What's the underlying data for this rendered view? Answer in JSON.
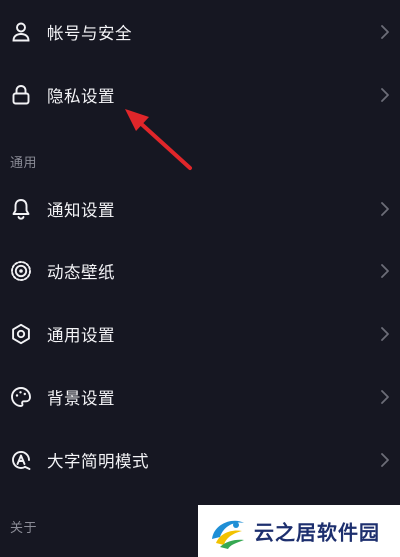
{
  "menu": {
    "account_security": "帐号与安全",
    "privacy": "隐私设置",
    "section_general": "通用",
    "notifications": "通知设置",
    "dynamic_wallpaper": "动态壁纸",
    "general_settings": "通用设置",
    "background": "背景设置",
    "large_text": "大字简明模式",
    "section_about": "关于"
  },
  "icons": {
    "account_security": "person-icon",
    "privacy": "lock-icon",
    "notifications": "bell-icon",
    "dynamic_wallpaper": "wallpaper-icon",
    "general_settings": "gear-icon",
    "background": "palette-icon",
    "large_text": "font-a-icon",
    "chevron": "chevron-right-icon"
  },
  "annotation": {
    "arrow_color": "#e0262a"
  },
  "watermark": {
    "text": "云之居软件园"
  },
  "colors": {
    "background": "#161722",
    "text": "#f4f4f7",
    "section_text": "#8a8b96",
    "chevron": "#6c6d78"
  }
}
